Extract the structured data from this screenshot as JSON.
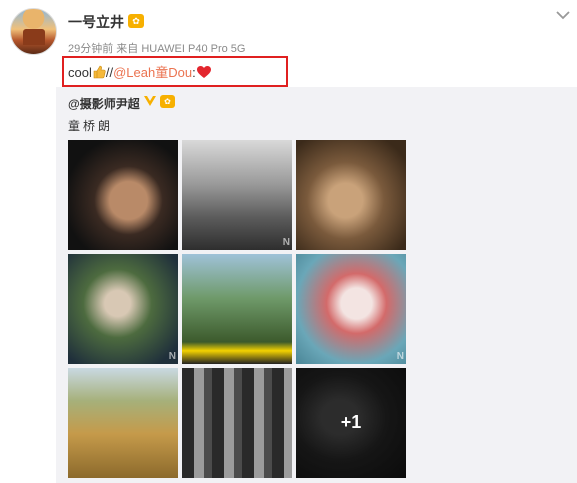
{
  "post": {
    "user_name": "一号立井",
    "vip_badge": "✿",
    "meta": "29分钟前 来自 HUAWEI P40 Pro 5G",
    "repost": {
      "prefix": "cool",
      "slash": "//",
      "mention": "@Leah童Dou",
      "colon": ":"
    }
  },
  "original": {
    "author": "@摄影师尹超",
    "vip_badge": "✿",
    "text": "童桥朗",
    "more_count": "+1",
    "watermark": "N"
  },
  "colors": {
    "mention": "#eb7350",
    "highlight_box": "#e02020",
    "panel": "#f2f2f5"
  }
}
